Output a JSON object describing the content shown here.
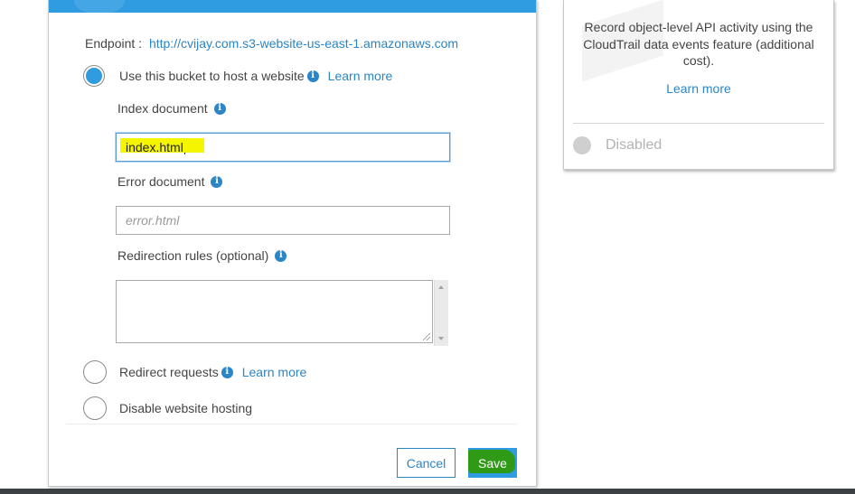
{
  "modal": {
    "endpoint_label": "Endpoint :",
    "endpoint_url": "http://cvijay.com.s3-website-us-east-1.amazonaws.com",
    "options": {
      "host": {
        "label": "Use this bucket to host a website",
        "learn_more": "Learn more",
        "selected": true
      },
      "redirect": {
        "label": "Redirect requests",
        "learn_more": "Learn more",
        "selected": false
      },
      "disable": {
        "label": "Disable website hosting",
        "selected": false
      }
    },
    "index_document": {
      "label": "Index document",
      "value": "index.html"
    },
    "error_document": {
      "label": "Error document",
      "placeholder": "error.html",
      "value": ""
    },
    "redirection_rules": {
      "label": "Redirection rules (optional)",
      "value": ""
    },
    "buttons": {
      "cancel": "Cancel",
      "save": "Save"
    }
  },
  "side_card": {
    "description": "Record object-level API activity using the CloudTrail data events feature (additional cost).",
    "learn_more": "Learn more",
    "status": "Disabled"
  },
  "icons": {
    "info": "info-icon"
  },
  "colors": {
    "accent": "#2f9be0",
    "link": "#2b85c6",
    "highlight_yellow": "#f5f500",
    "highlight_green": "#2e9a16"
  }
}
